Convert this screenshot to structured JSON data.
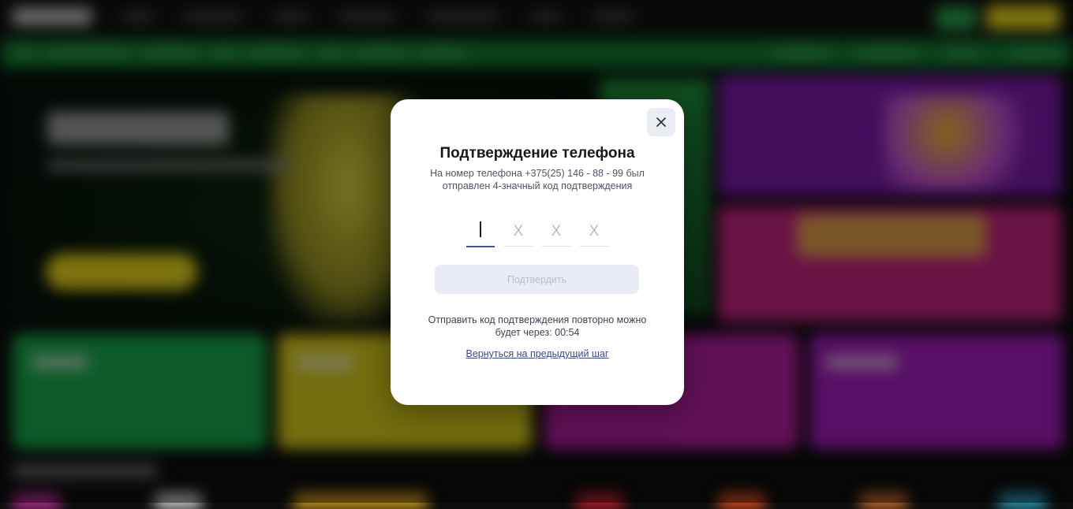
{
  "modal": {
    "title": "Подтверждение телефона",
    "description": "На номер телефона +375(25) 146 - 88 - 99 был отправлен 4-значный код подтверждения",
    "code_placeholder": "X",
    "submit_label": "Подтвердить",
    "resend_text": "Отправить код подтверждения повторно можно будет через: 00:54",
    "back_link": "Вернуться на предыдущий шаг",
    "close_icon": "close-icon"
  },
  "colors": {
    "accent": "#3c54a8",
    "button_disabled": "#e9ebf5",
    "link": "#3b4a8e"
  }
}
